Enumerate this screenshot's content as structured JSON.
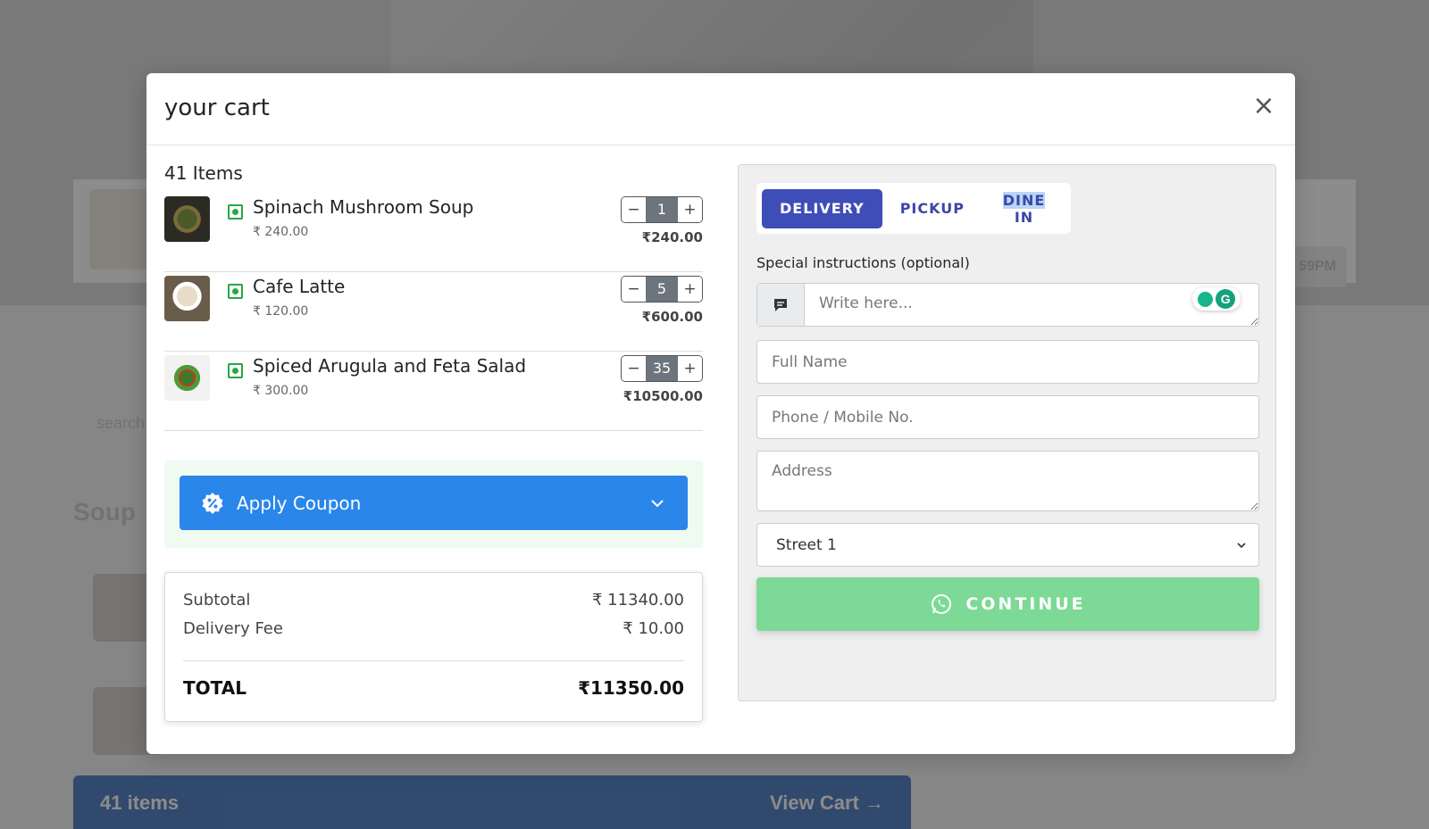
{
  "background": {
    "hours_badge": "59PM",
    "search_hint": "search",
    "section_title": "Soup",
    "bottom_bar": {
      "items_label": "41 items",
      "view_cart_label": "View Cart →"
    }
  },
  "modal": {
    "title": "your cart",
    "close_label": "×"
  },
  "cart": {
    "items_count_label": "41 Items",
    "items": [
      {
        "name": "Spinach Mushroom Soup",
        "unit_price": "₹ 240.00",
        "qty": "1",
        "line_total": "₹240.00"
      },
      {
        "name": "Cafe Latte",
        "unit_price": "₹ 120.00",
        "qty": "5",
        "line_total": "₹600.00"
      },
      {
        "name": "Spiced Arugula and Feta Salad",
        "unit_price": "₹ 300.00",
        "qty": "35",
        "line_total": "₹10500.00"
      }
    ],
    "qty_minus": "−",
    "qty_plus": "+",
    "coupon_label": "Apply Coupon",
    "summary": {
      "subtotal_label": "Subtotal",
      "subtotal_value": "₹ 11340.00",
      "delivery_label": "Delivery Fee",
      "delivery_value": "₹ 10.00",
      "total_label": "TOTAL",
      "total_value": "₹11350.00"
    }
  },
  "checkout": {
    "tabs": {
      "delivery": "DELIVERY",
      "pickup": "PICKUP",
      "dine_in_selected": "DINE",
      "dine_in_rest": " IN"
    },
    "active_tab": "delivery",
    "special_label": "Special instructions (optional)",
    "special_placeholder": "Write here...",
    "name_placeholder": "Full Name",
    "phone_placeholder": "Phone / Mobile No.",
    "address_placeholder": "Address",
    "street_selected": "Street 1",
    "continue_label": "CONTINUE"
  },
  "colors": {
    "primary_blue": "#2b86ea",
    "tab_active": "#3f4db8",
    "continue_green": "#7dd996",
    "veg_green": "#28a745"
  }
}
